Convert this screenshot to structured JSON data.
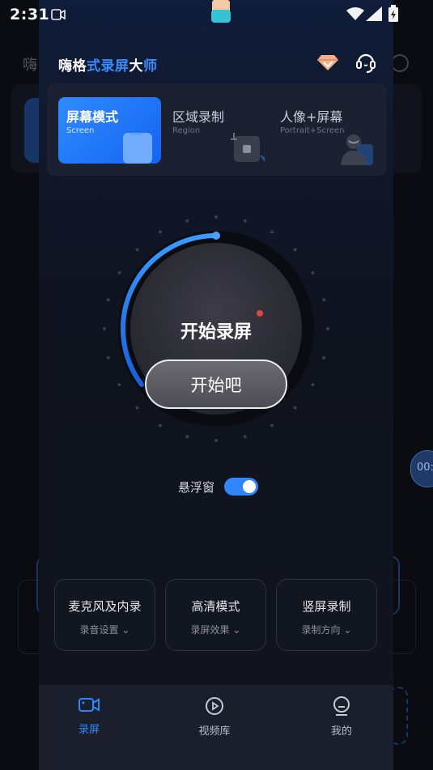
{
  "status_bar": {
    "time": "2:31"
  },
  "background_app": {
    "title_fragment": "嗨",
    "pill_text": "00:"
  },
  "header": {
    "title_parts": [
      "嗨格",
      "式录屏",
      "大",
      "师"
    ],
    "vip_icon": "diamond-icon",
    "service_icon": "headset-icon"
  },
  "modes": [
    {
      "name": "屏幕模式",
      "sub": "Screen",
      "active": true
    },
    {
      "name": "区域录制",
      "sub": "Region",
      "active": false
    },
    {
      "name": "人像+屏幕",
      "sub": "Portrait+Screen",
      "active": false
    }
  ],
  "record": {
    "title": "开始录屏",
    "button": "开始吧"
  },
  "floating_window": {
    "label": "悬浮窗",
    "enabled": true
  },
  "options": [
    {
      "title": "麦克风及内录",
      "sub": "录音设置"
    },
    {
      "title": "高清模式",
      "sub": "录屏效果"
    },
    {
      "title": "竖屏录制",
      "sub": "录制方向"
    }
  ],
  "nav": [
    {
      "label": "录屏",
      "icon": "camera-icon",
      "active": true
    },
    {
      "label": "视频库",
      "icon": "play-circle-icon",
      "active": false
    },
    {
      "label": "我的",
      "icon": "profile-icon",
      "active": false
    }
  ],
  "colors": {
    "accent": "#2f86ff",
    "panel_bg": "#12151d"
  }
}
